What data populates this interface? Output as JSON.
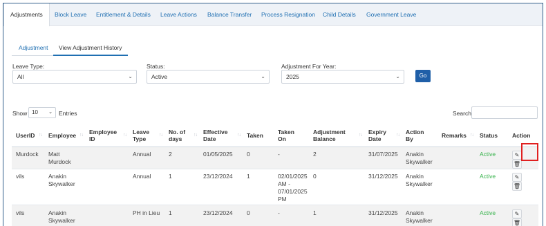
{
  "tabs": [
    "Adjustments",
    "Block Leave",
    "Entitlement & Details",
    "Leave Actions",
    "Balance Transfer",
    "Process Resignation",
    "Child Details",
    "Government Leave"
  ],
  "subtabs": [
    "Adjustment",
    "View Adjustment History"
  ],
  "filters": {
    "leave_type": {
      "label": "Leave Type:",
      "value": "All"
    },
    "status": {
      "label": "Status:",
      "value": "Active"
    },
    "year": {
      "label": "Adjustment For Year:",
      "value": "2025"
    },
    "go_label": "Go"
  },
  "table_controls": {
    "show_label": "Show",
    "page_size": "10",
    "entries_label": "Entries",
    "search_label": "Search"
  },
  "columns": [
    [
      "UserID"
    ],
    [
      "Employee"
    ],
    [
      "Employee",
      "ID"
    ],
    [
      "Leave",
      "Type"
    ],
    [
      "No. of",
      "days"
    ],
    [
      "Effective",
      "Date"
    ],
    [
      "Taken"
    ],
    [
      "Taken",
      "On"
    ],
    [
      "Adjustment",
      "Balance"
    ],
    [
      "Expiry",
      "Date"
    ],
    [
      "Action",
      "By"
    ],
    [
      "Remarks"
    ],
    [
      "Status"
    ],
    [
      "Action"
    ]
  ],
  "rows": [
    {
      "user_id": "Murdock",
      "employee": [
        "Matt Murdock"
      ],
      "employee_id": "",
      "leave_type": [
        "Annual"
      ],
      "days": "2",
      "effective": "01/05/2025",
      "taken": "0",
      "taken_on": [
        "-"
      ],
      "balance": "2",
      "expiry": "31/07/2025",
      "action_by": [
        "Anakin",
        "Skywalker"
      ],
      "remarks": "",
      "status": "Active"
    },
    {
      "user_id": "vils",
      "employee": [
        "Anakin",
        "Skywalker"
      ],
      "employee_id": "",
      "leave_type": [
        "Annual"
      ],
      "days": "1",
      "effective": "23/12/2024",
      "taken": "1",
      "taken_on": [
        "02/01/2025",
        "AM -",
        "07/01/2025",
        "PM"
      ],
      "balance": "0",
      "expiry": "31/12/2025",
      "action_by": [
        "Anakin",
        "Skywalker"
      ],
      "remarks": "",
      "status": "Active"
    },
    {
      "user_id": "vils",
      "employee": [
        "Anakin",
        "Skywalker"
      ],
      "employee_id": "",
      "leave_type": [
        "PH in Lieu"
      ],
      "days": "1",
      "effective": "23/12/2024",
      "taken": "0",
      "taken_on": [
        "-"
      ],
      "balance": "1",
      "expiry": "31/12/2025",
      "action_by": [
        "Anakin",
        "Skywalker"
      ],
      "remarks": "",
      "status": "Active"
    }
  ],
  "icons": {
    "edit": "pencil-icon",
    "delete": "trash-icon",
    "sort": "sort-arrows-icon",
    "dropdown": "chevron-down-icon"
  },
  "colors": {
    "link": "#1f6fb2",
    "primary_button": "#1f5fa8",
    "status_active": "#35b24a",
    "highlight": "#e02020"
  }
}
